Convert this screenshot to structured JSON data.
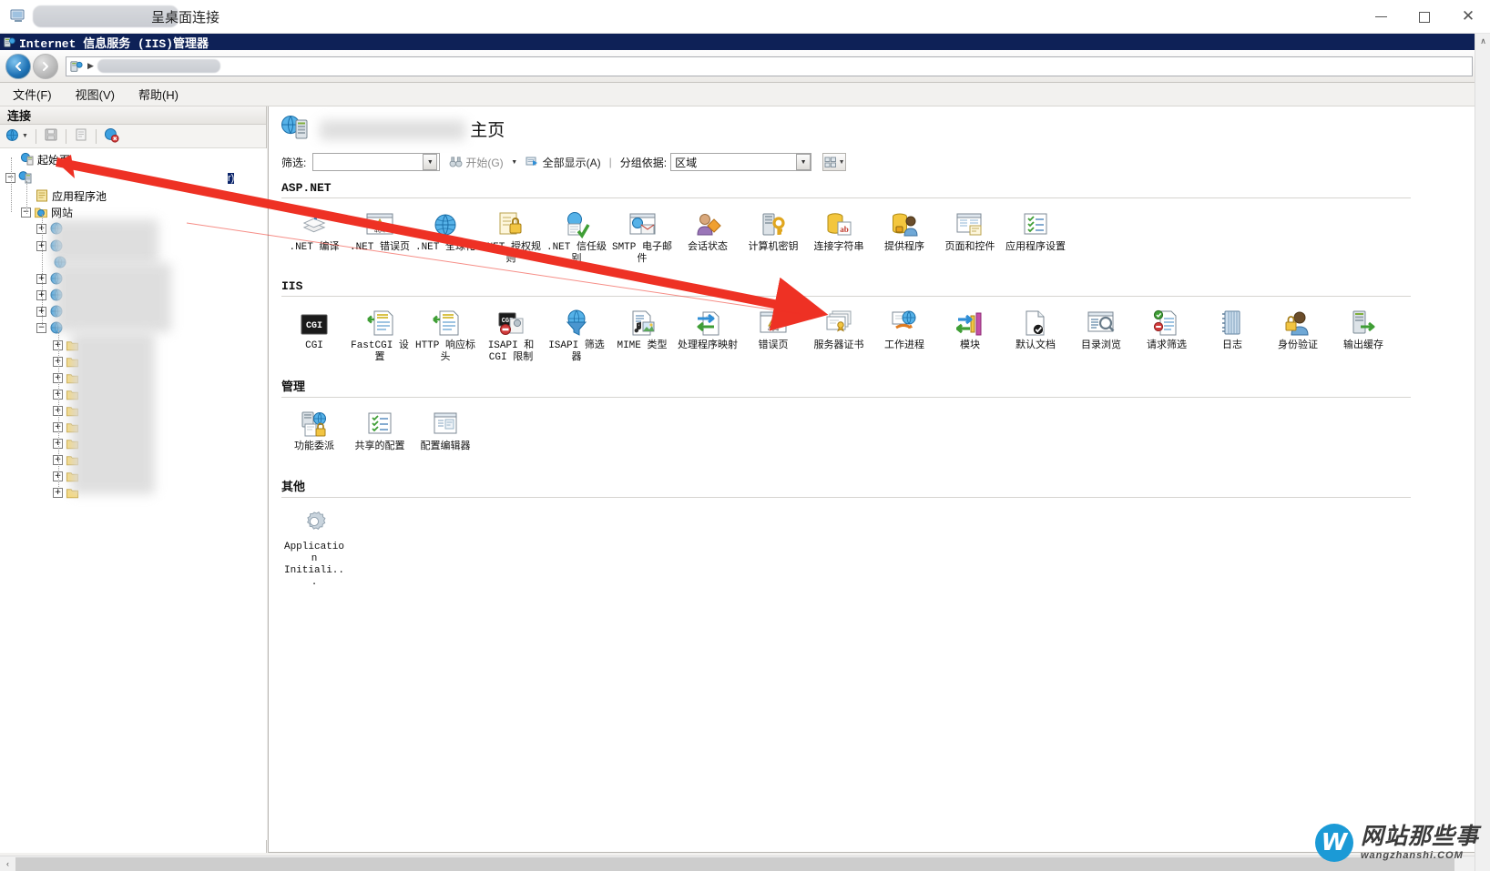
{
  "rdp_window": {
    "title": "呈桌面连接",
    "icon": "remote-desktop-icon",
    "minimize": "—",
    "maximize": "□",
    "close": "✕"
  },
  "iis_window": {
    "titlebar": "Internet 信息服务 (IIS)管理器",
    "titlebar_icon": "iis-server-icon"
  },
  "nav": {
    "back_glyph": "◀",
    "forward_glyph": "▶",
    "address_separator": "▶",
    "address_value": ""
  },
  "menu": {
    "items": [
      {
        "label": "文件(F)",
        "name": "menu-file"
      },
      {
        "label": "视图(V)",
        "name": "menu-view"
      },
      {
        "label": "帮助(H)",
        "name": "menu-help"
      }
    ]
  },
  "connections": {
    "header": "连接",
    "toolbar": [
      {
        "name": "connect-to-server-icon",
        "glyph": "globe"
      },
      {
        "name": "save-icon",
        "glyph": "save"
      },
      {
        "name": "new-site-icon",
        "glyph": "page"
      },
      {
        "name": "disconnect-icon",
        "glyph": "globe-x"
      }
    ],
    "tree": [
      {
        "label": "起始页",
        "indent": 0,
        "expander": "",
        "icon": "start-page-icon",
        "redacted": true
      },
      {
        "label": "",
        "indent": 0,
        "expander": "−",
        "icon": "server-icon",
        "selected": true,
        "suffix": "r)"
      },
      {
        "label": "应用程序池",
        "indent": 1,
        "expander": "",
        "icon": "app-pools-icon"
      },
      {
        "label": "网站",
        "indent": 1,
        "expander": "−",
        "icon": "sites-folder-icon"
      },
      {
        "label": "",
        "indent": 2,
        "expander": "+",
        "icon": "site-icon"
      },
      {
        "label": "",
        "indent": 2,
        "expander": "+",
        "icon": "site-icon"
      },
      {
        "label": "",
        "indent": 2,
        "expander": "",
        "icon": "site-icon"
      },
      {
        "label": "",
        "indent": 2,
        "expander": "+",
        "icon": "site-icon"
      },
      {
        "label": "",
        "indent": 2,
        "expander": "+",
        "icon": "site-icon"
      },
      {
        "label": "",
        "indent": 2,
        "expander": "+",
        "icon": "site-icon"
      },
      {
        "label": "",
        "indent": 2,
        "expander": "−",
        "icon": "site-icon"
      },
      {
        "label": "",
        "indent": 3,
        "expander": "+",
        "icon": "folder-icon"
      },
      {
        "label": "",
        "indent": 3,
        "expander": "+",
        "icon": "folder-icon"
      },
      {
        "label": "",
        "indent": 3,
        "expander": "+",
        "icon": "folder-icon"
      },
      {
        "label": "",
        "indent": 3,
        "expander": "+",
        "icon": "folder-icon"
      },
      {
        "label": "",
        "indent": 3,
        "expander": "+",
        "icon": "folder-icon"
      },
      {
        "label": "",
        "indent": 3,
        "expander": "+",
        "icon": "folder-icon"
      },
      {
        "label": "",
        "indent": 3,
        "expander": "+",
        "icon": "folder-icon"
      },
      {
        "label": "",
        "indent": 3,
        "expander": "+",
        "icon": "folder-icon"
      },
      {
        "label": "",
        "indent": 3,
        "expander": "+",
        "icon": "folder-icon"
      },
      {
        "label": "",
        "indent": 3,
        "expander": "+",
        "icon": "folder-icon"
      }
    ]
  },
  "content": {
    "page_title_suffix": "主页",
    "page_title_icon": "website-icon",
    "filter": {
      "label": "筛选:",
      "value": "",
      "placeholder": "",
      "go_label": "开始(G)",
      "show_all_label": "全部显示(A)",
      "group_by_label": "分组依据:",
      "group_by_value": "区域",
      "view_button": "view-options-button"
    },
    "groups": [
      {
        "name": "ASP.NET",
        "title": "ASP.NET",
        "features": [
          {
            "label": ".NET 编译",
            "icon": "net-compilation-icon"
          },
          {
            "label": ".NET 错误页",
            "icon": "net-error-pages-icon"
          },
          {
            "label": ".NET 全球化",
            "icon": "net-globalization-icon"
          },
          {
            "label": ".NET 授权规则",
            "icon": "net-authorization-rules-icon"
          },
          {
            "label": ".NET 信任级别",
            "icon": "net-trust-levels-icon"
          },
          {
            "label": "SMTP 电子邮件",
            "icon": "smtp-email-icon"
          },
          {
            "label": "会话状态",
            "icon": "session-state-icon"
          },
          {
            "label": "计算机密钥",
            "icon": "machine-key-icon"
          },
          {
            "label": "连接字符串",
            "icon": "connection-strings-icon"
          },
          {
            "label": "提供程序",
            "icon": "providers-icon"
          },
          {
            "label": "页面和控件",
            "icon": "pages-and-controls-icon"
          },
          {
            "label": "应用程序设置",
            "icon": "application-settings-icon"
          }
        ]
      },
      {
        "name": "IIS",
        "title": "IIS",
        "features": [
          {
            "label": "CGI",
            "icon": "cgi-icon"
          },
          {
            "label": "FastCGI 设置",
            "icon": "fastcgi-settings-icon"
          },
          {
            "label": "HTTP 响应标头",
            "icon": "http-response-headers-icon"
          },
          {
            "label": "ISAPI 和 CGI 限制",
            "icon": "isapi-cgi-restrictions-icon"
          },
          {
            "label": "ISAPI 筛选器",
            "icon": "isapi-filters-icon"
          },
          {
            "label": "MIME 类型",
            "icon": "mime-types-icon"
          },
          {
            "label": "处理程序映射",
            "icon": "handler-mappings-icon"
          },
          {
            "label": "错误页",
            "icon": "error-pages-icon"
          },
          {
            "label": "服务器证书",
            "icon": "server-certificates-icon",
            "highlight": true
          },
          {
            "label": "工作进程",
            "icon": "worker-processes-icon"
          },
          {
            "label": "模块",
            "icon": "modules-icon"
          },
          {
            "label": "默认文档",
            "icon": "default-document-icon"
          },
          {
            "label": "目录浏览",
            "icon": "directory-browsing-icon"
          },
          {
            "label": "请求筛选",
            "icon": "request-filtering-icon"
          },
          {
            "label": "日志",
            "icon": "logging-icon"
          },
          {
            "label": "身份验证",
            "icon": "authentication-icon"
          },
          {
            "label": "输出缓存",
            "icon": "output-caching-icon"
          }
        ]
      },
      {
        "name": "管理",
        "title": "管理",
        "features": [
          {
            "label": "功能委派",
            "icon": "feature-delegation-icon"
          },
          {
            "label": "共享的配置",
            "icon": "shared-configuration-icon"
          },
          {
            "label": "配置编辑器",
            "icon": "configuration-editor-icon"
          }
        ]
      },
      {
        "name": "其他",
        "title": "其他",
        "features": [
          {
            "label": "Application Initiali...",
            "icon": "application-initialization-icon"
          }
        ]
      }
    ]
  },
  "watermark": {
    "mark": "W",
    "cn_text": "网站那些事",
    "en_text": "wangzhanshi.COM",
    "color": "#1b9ad6"
  },
  "scrollbars": {
    "vertical_up": "∧",
    "vertical_down": "∨",
    "horizontal_left": "‹",
    "horizontal_right": "›"
  },
  "colors": {
    "title_bar": "#0e2157",
    "selection": "#0a246a",
    "arrow": "#ee3124"
  }
}
